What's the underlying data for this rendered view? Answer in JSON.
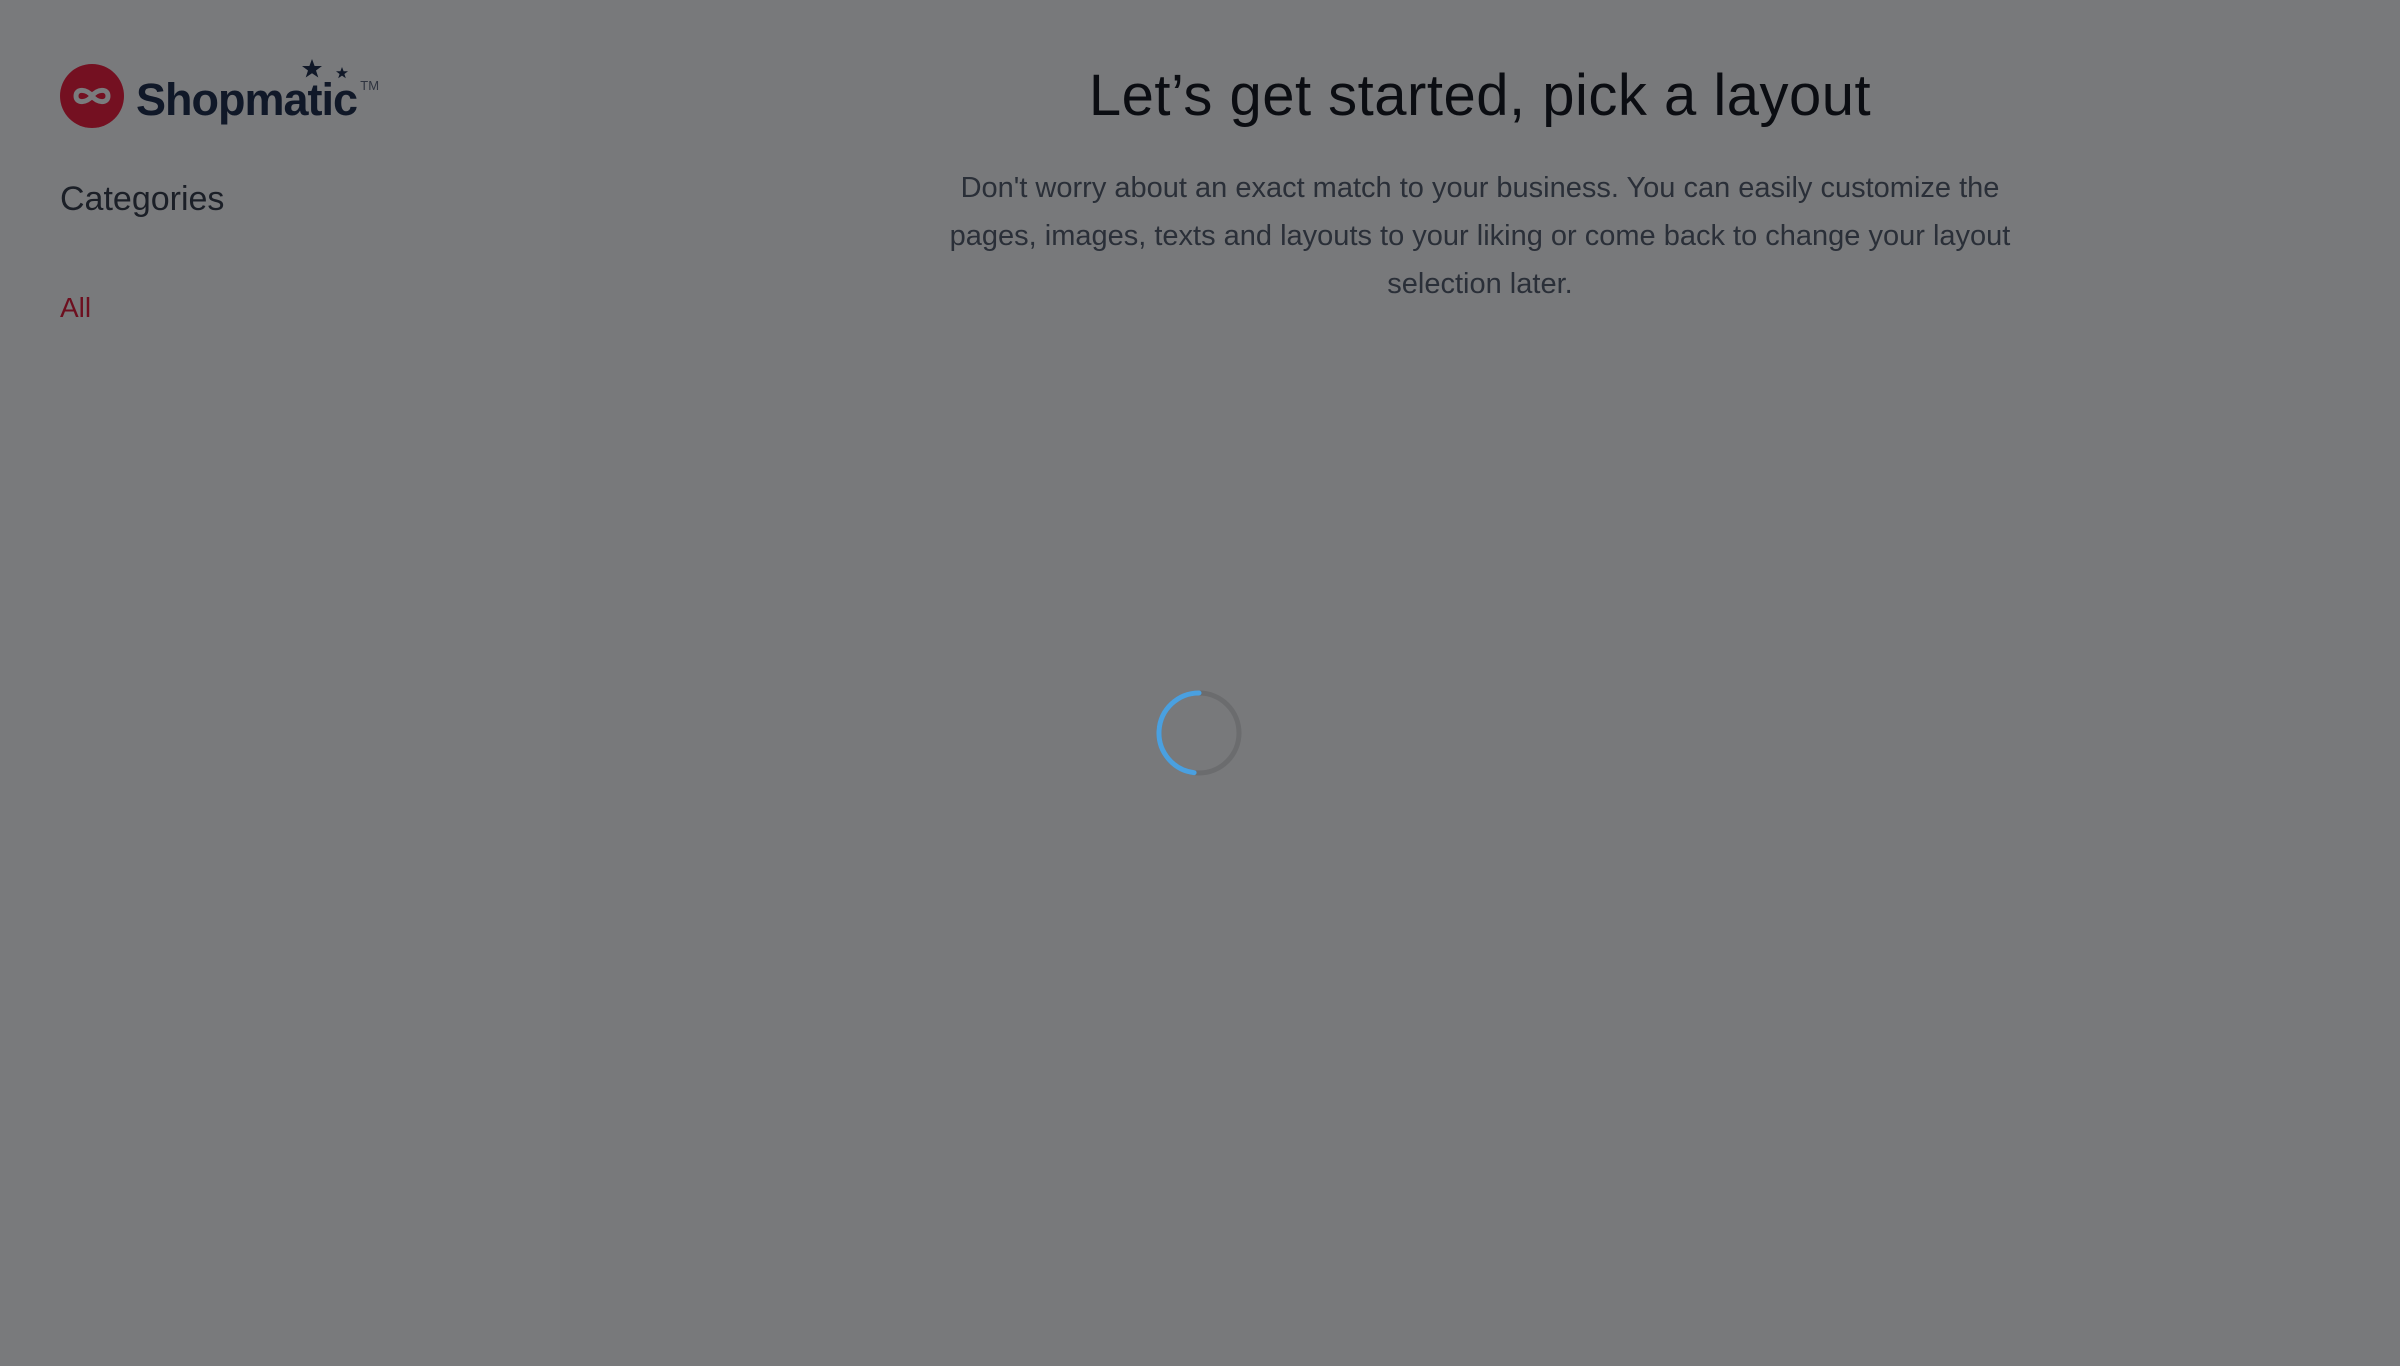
{
  "brand": {
    "name": "Shopmatic",
    "trademark": "TM",
    "colors": {
      "mark": "#741021",
      "text": "#101828"
    }
  },
  "sidebar": {
    "title": "Categories",
    "items": [
      {
        "label": "All",
        "active": true
      }
    ],
    "colors": {
      "active_item": "#6d0f1f"
    }
  },
  "main": {
    "title": "Let’s get started, pick a layout",
    "subtitle": "Don't worry about an exact match to your business. You can easily customize the pages, images, texts and layouts to your liking or come back to change your layout selection later.",
    "loading": true,
    "spinner_icon": "loading-spinner-icon",
    "colors": {
      "spinner_arc": "#4aa0e0",
      "spinner_track": "#6b6c6e",
      "overlay_background": "#78797b"
    }
  }
}
